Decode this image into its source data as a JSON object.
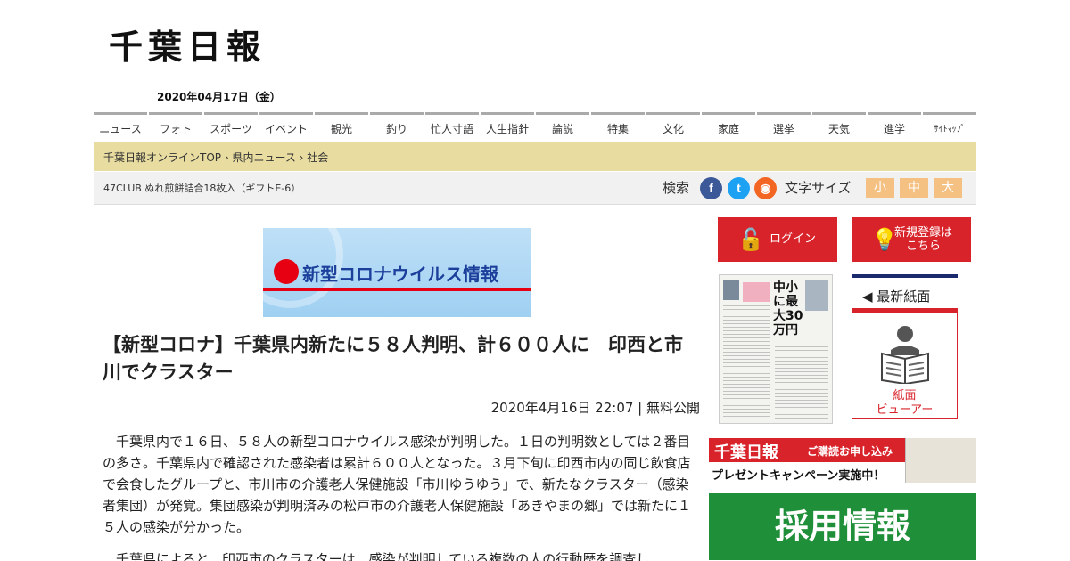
{
  "site": {
    "logo": "千葉日報",
    "date": "2020年04月17日（金）"
  },
  "nav": {
    "items": [
      "ニュース",
      "フォト",
      "スポーツ",
      "イベント",
      "観光",
      "釣り",
      "忙人寸語",
      "人生指針",
      "論説",
      "特集",
      "文化",
      "家庭",
      "選挙",
      "天気",
      "進学",
      "ｻｲﾄﾏｯﾌﾟ"
    ]
  },
  "breadcrumb": {
    "items": [
      "千葉日報オンラインTOP",
      "県内ニュース",
      "社会"
    ],
    "separator": " › "
  },
  "subbar": {
    "promo": "47CLUB ぬれ煎餅詰合18枚入（ギフトE-6）",
    "search_label": "検索",
    "font_size_label": "文字サイズ",
    "font_sizes": [
      "小",
      "中",
      "大"
    ]
  },
  "social": [
    {
      "icon": "facebook-icon",
      "glyph": "f",
      "color": "#3b5998"
    },
    {
      "icon": "twitter-icon",
      "glyph": "t",
      "color": "#1da1f2"
    },
    {
      "icon": "rss-icon",
      "glyph": "◉",
      "color": "#f26522"
    }
  ],
  "banner": {
    "text": "新型コロナウイルス情報"
  },
  "article": {
    "headline": "【新型コロナ】千葉県内新たに５８人判明、計６００人に　印西と市川でクラスター",
    "meta": "2020年4月16日 22:07 | 無料公開",
    "paragraphs": [
      "千葉県内で１６日、５８人の新型コロナウイルス感染が判明した。１日の判明数としては２番目の多さ。千葉県内で確認された感染者は累計６００人となった。３月下旬に印西市内の同じ飲食店で会食したグループと、市川市の介護老人保健施設「市川ゆうゆう」で、新たなクラスター（感染者集団）が発覚。集団感染が判明済みの松戸市の介護老人保健施設「あきやまの郷」では新たに１５人の感染が分かった。",
      "千葉県によると、印西市のクラスターは、感染が判明している複数の人の行動歴を調査し"
    ]
  },
  "sidebar": {
    "login_label": "ログイン",
    "register_label": "新規登録は\nこちら",
    "latest_title": "◀ 最新紙面",
    "viewer_label": "紙面\nビューアー",
    "paper_headline": "中小に最大30万円",
    "subscribe": {
      "logo": "千葉日報",
      "tag": "ご購読お申し込み",
      "campaign": "プレゼントキャンペーン実施中！"
    },
    "recruit_label": "採用情報"
  },
  "colors": {
    "accent_red": "#d8232a",
    "breadcrumb_bg": "#e8dca0",
    "recruit_green": "#1f8f3a",
    "fontsize_btn": "#f4c182"
  }
}
